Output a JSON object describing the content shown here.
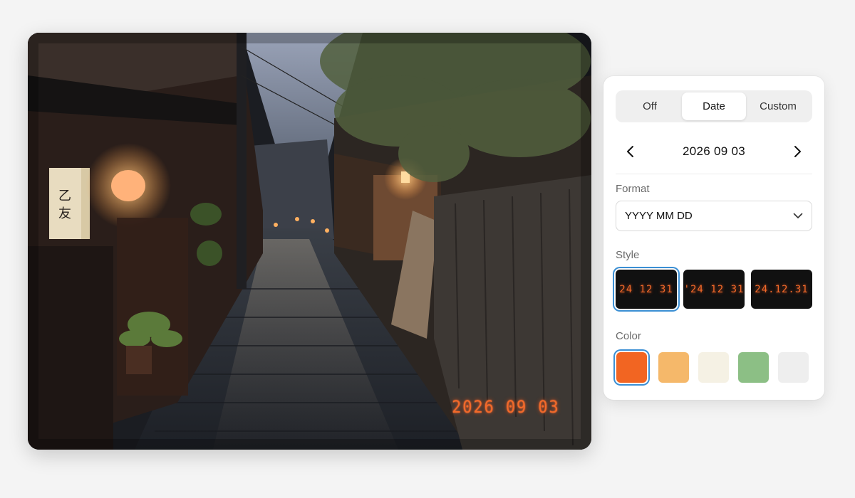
{
  "photo": {
    "date_stamp": "2026 09 03",
    "lantern_text": "乙友"
  },
  "panel": {
    "modes": [
      {
        "label": "Off",
        "active": false
      },
      {
        "label": "Date",
        "active": true
      },
      {
        "label": "Custom",
        "active": false
      }
    ],
    "date": {
      "value": "2026 09 03",
      "prev_icon": "chevron-left-icon",
      "next_icon": "chevron-right-icon"
    },
    "format": {
      "label": "Format",
      "value": "YYYY MM DD",
      "icon": "chevron-down-icon"
    },
    "style": {
      "label": "Style",
      "options": [
        "24 12 31",
        "'24 12 31",
        "24.12.31"
      ],
      "selected_index": 0
    },
    "color": {
      "label": "Color",
      "swatches": [
        "#f26522",
        "#f5b86a",
        "#f5f1e4",
        "#8cbf85",
        "#eeeeee"
      ],
      "selected_index": 0
    },
    "accent": "#3b8fd4"
  }
}
